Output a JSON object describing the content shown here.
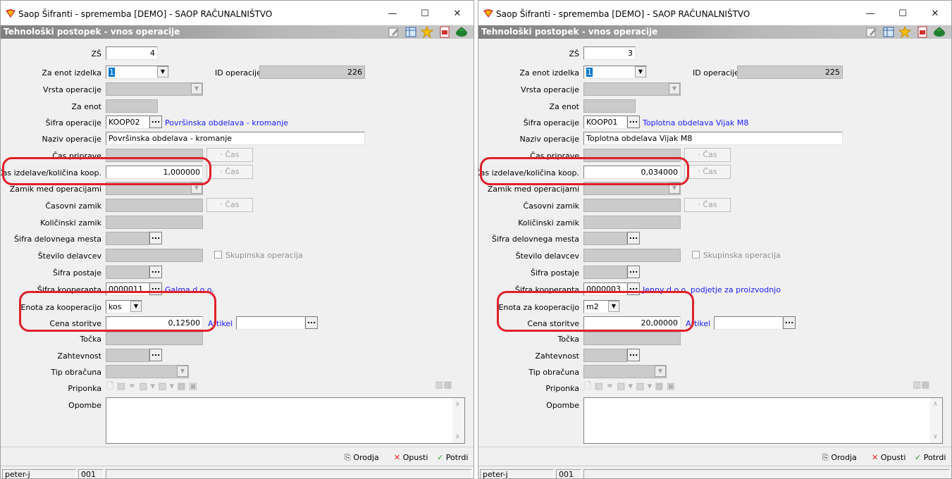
{
  "windows": [
    {
      "title": "Saop Šifranti - sprememba [DEMO] - SAOP RAČUNALNIŠTVO",
      "header": "Tehnološki postopek - vnos operacije",
      "labels": {
        "zs": "ZŠ",
        "za_enot_izdelka": "Za enot izdelka",
        "id_operacije": "ID operacije",
        "vrsta_operacije": "Vrsta operacije",
        "za_enot": "Za enot",
        "sifra_operacije": "Šifra operacije",
        "naziv_operacije": "Naziv operacije",
        "cas_priprave": "Čas priprave",
        "cas_izdelave": "Čas izdelave/količina koop.",
        "zamik_med_operacijami": "Zamik med operacijami",
        "casovni_zamik": "Časovni zamik",
        "kolicinski_zamik": "Količinski zamik",
        "sifra_delovnega_mesta": "Šifra delovnega mesta",
        "stevilo_delavcev": "Število delavcev",
        "sifra_postaje": "Šifra postaje",
        "sifra_kooperanta": "Šifra kooperanta",
        "enota_za_kooperacijo": "Enota za kooperacijo",
        "cena_storitve": "Cena storitve",
        "tocka": "Točka",
        "zahtevnost": "Zahtevnost",
        "tip_obracuna": "Tip obračuna",
        "priponka": "Priponka",
        "opombe": "Opombe",
        "artikel": "Artikel",
        "cas_button": "· Čas",
        "skupinska_operacija": "Skupinska operacija"
      },
      "values": {
        "zs": "4",
        "za_enot_izdelka": "1",
        "id_operacije": "226",
        "sifra_operacije": "KOOP02",
        "sifra_operacije_naziv": "Površinska obdelava - kromanje",
        "naziv_operacije": "Površinska obdelava - kromanje",
        "cas_izdelave": "1,000000",
        "sifra_kooperanta": "0000011",
        "kooperant_naziv": "Galma d.o.o.",
        "enota_za_kooperacijo": "kos",
        "cena_storitve": "0,12500"
      },
      "buttons": {
        "orodja": "Orodja",
        "opusti": "Opusti",
        "potrdi": "Potrdi"
      },
      "status": {
        "user": "peter-j",
        "code": "001"
      }
    },
    {
      "title": "Saop Šifranti - sprememba [DEMO] - SAOP RAČUNALNIŠTVO",
      "header": "Tehnološki postopek - vnos operacije",
      "labels": {
        "zs": "ZŠ",
        "za_enot_izdelka": "Za enot izdelka",
        "id_operacije": "ID operacije",
        "vrsta_operacije": "Vrsta operacije",
        "za_enot": "Za enot",
        "sifra_operacije": "Šifra operacije",
        "naziv_operacije": "Naziv operacije",
        "cas_priprave": "Čas priprave",
        "cas_izdelave": "Čas izdelave/količina koop.",
        "zamik_med_operacijami": "Zamik med operacijami",
        "casovni_zamik": "Časovni zamik",
        "kolicinski_zamik": "Količinski zamik",
        "sifra_delovnega_mesta": "Šifra delovnega mesta",
        "stevilo_delavcev": "Število delavcev",
        "sifra_postaje": "Šifra postaje",
        "sifra_kooperanta": "Šifra kooperanta",
        "enota_za_kooperacijo": "Enota za kooperacijo",
        "cena_storitve": "Cena storitve",
        "tocka": "Točka",
        "zahtevnost": "Zahtevnost",
        "tip_obracuna": "Tip obračuna",
        "priponka": "Priponka",
        "opombe": "Opombe",
        "artikel": "Artikel",
        "cas_button": "· Čas",
        "skupinska_operacija": "Skupinska operacija"
      },
      "values": {
        "zs": "3",
        "za_enot_izdelka": "1",
        "id_operacije": "225",
        "sifra_operacije": "KOOP01",
        "sifra_operacije_naziv": "Toplotna obdelava Vijak M8",
        "naziv_operacije": "Toplotna obdelava Vijak M8",
        "cas_izdelave": "0,034000",
        "sifra_kooperanta": "0000003",
        "kooperant_naziv": "Jenny d.o.o. podjetje za proizvodnjo",
        "enota_za_kooperacijo": "m2",
        "cena_storitve": "20,00000"
      },
      "buttons": {
        "orodja": "Orodja",
        "opusti": "Opusti",
        "potrdi": "Potrdi"
      },
      "status": {
        "user": "peter-j",
        "code": "001"
      }
    }
  ],
  "window_controls": {
    "minimize": "—",
    "maximize": "☐",
    "close": "✕"
  },
  "colors": {
    "highlight": "#e0202a",
    "link": "#1a1aff",
    "header_gradient_start": "#7f7f7f"
  }
}
